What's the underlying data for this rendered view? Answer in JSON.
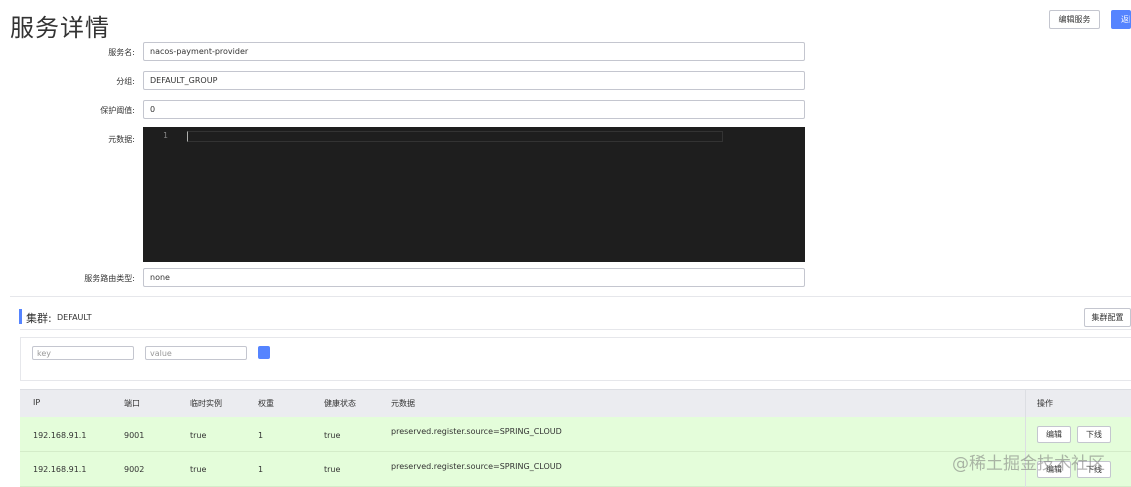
{
  "header": {
    "title": "服务详情",
    "edit_button": "编辑服务",
    "back_button": "返回"
  },
  "form": {
    "service_name_label": "服务名:",
    "service_name_value": "nacos-payment-provider",
    "group_label": "分组:",
    "group_value": "DEFAULT_GROUP",
    "threshold_label": "保护阈值:",
    "threshold_value": "0",
    "metadata_label": "元数据:",
    "metadata_line_number": "1",
    "route_type_label": "服务路由类型:",
    "route_type_value": "none"
  },
  "cluster": {
    "title": "集群:",
    "name": "DEFAULT",
    "config_button": "集群配置",
    "filter_key_placeholder": "key",
    "filter_value_placeholder": "value"
  },
  "table": {
    "headers": [
      "IP",
      "端口",
      "临时实例",
      "权重",
      "健康状态",
      "元数据",
      "操作"
    ],
    "rows": [
      {
        "ip": "192.168.91.1",
        "port": "9001",
        "ephemeral": "true",
        "weight": "1",
        "healthy": "true",
        "metadata": "preserved.register.source=SPRING_CLOUD",
        "edit": "编辑",
        "offline": "下线"
      },
      {
        "ip": "192.168.91.1",
        "port": "9002",
        "ephemeral": "true",
        "weight": "1",
        "healthy": "true",
        "metadata": "preserved.register.source=SPRING_CLOUD",
        "edit": "编辑",
        "offline": "下线"
      }
    ]
  },
  "watermark": "@稀土掘金技术社区",
  "colors": {
    "primary": "#5584ff",
    "editor_bg": "#1e1e1e",
    "row_bg": "#e4fdda",
    "header_bg": "#ebecf0"
  }
}
